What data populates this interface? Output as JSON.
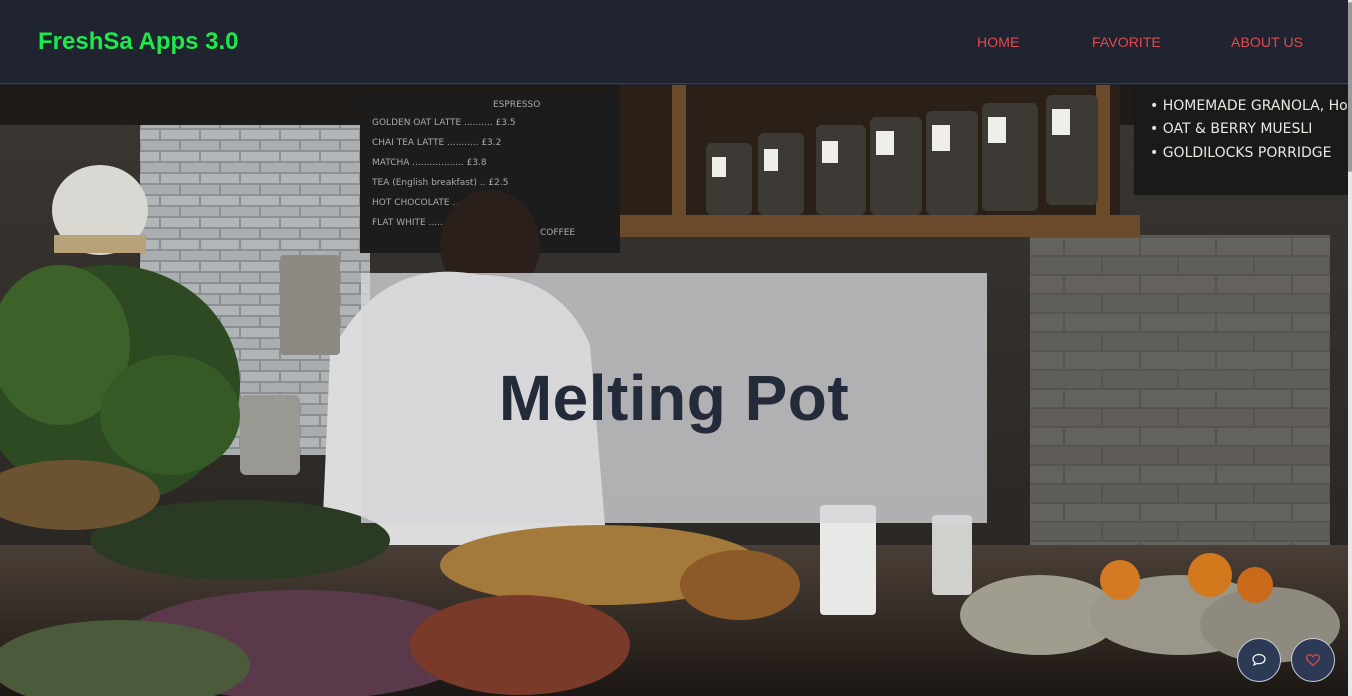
{
  "header": {
    "brand": "FreshSa Apps 3.0",
    "nav": [
      {
        "label": "HOME"
      },
      {
        "label": "FAVORITE"
      },
      {
        "label": "ABOUT US"
      }
    ]
  },
  "hero": {
    "title": "Melting Pot",
    "chalkboard_right": [
      "• HOMEMADE GRANOLA, Honey & Sam",
      "• OAT & BERRY MUESLI",
      "• GOLDILOCKS PORRIDGE"
    ],
    "chalkboard_left_heading": "ESPRESSO",
    "chalkboard_left_coffee": "COFFEE"
  },
  "actions": {
    "chat_icon": "chat-bubble-icon",
    "favorite_icon": "heart-icon"
  },
  "colors": {
    "navbar_bg": "#1f2430",
    "brand": "#1fe84a",
    "nav_link": "#e5484d",
    "hero_title": "#232a3a",
    "fab_bg": "#2d3a55"
  }
}
